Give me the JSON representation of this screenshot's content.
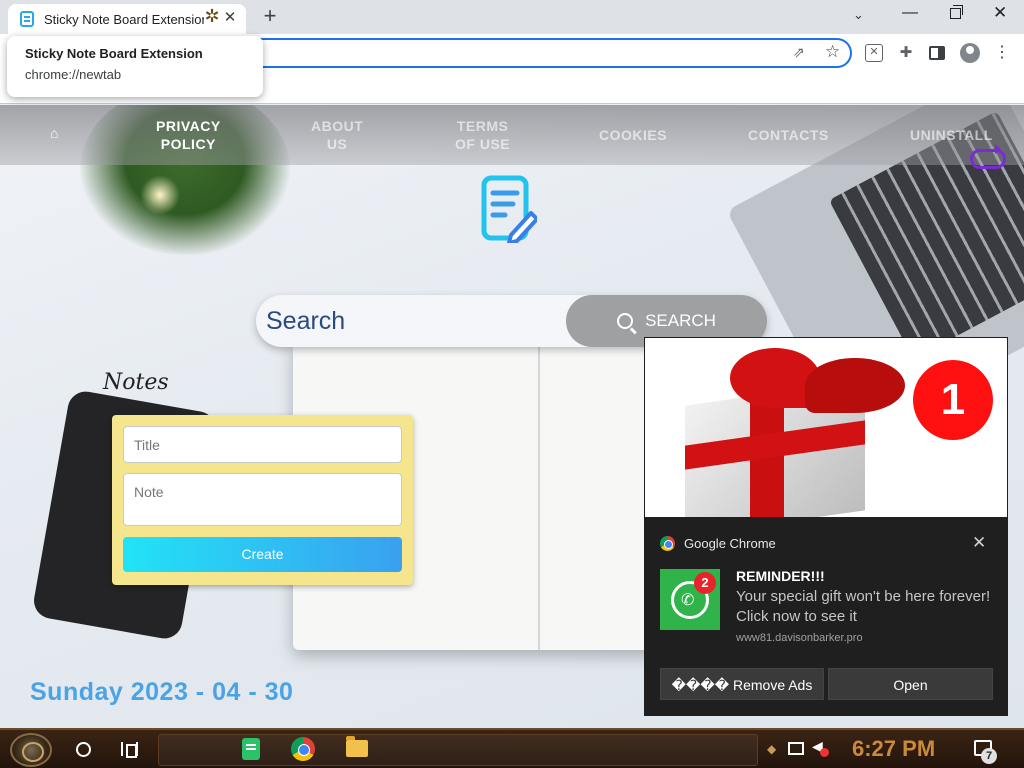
{
  "browser": {
    "tab_title": "Sticky Note Board Extension",
    "hover_card": {
      "title": "Sticky Note Board Extension",
      "url": "chrome://newtab"
    }
  },
  "nav": {
    "privacy": "PRIVACY\nPOLICY",
    "about": "ABOUT\nUS",
    "terms": "TERMS\nOF USE",
    "cookies": "COOKIES",
    "contacts": "CONTACTS",
    "uninstall": "UNINSTALL"
  },
  "search": {
    "placeholder": "Search",
    "button_label": "SEARCH"
  },
  "notes": {
    "heading": "Notes",
    "title_placeholder": "Title",
    "note_placeholder": "Note",
    "create_label": "Create"
  },
  "date": "Sunday 2023 - 04 - 30",
  "notification": {
    "badge_image": "1",
    "app_name": "Google Chrome",
    "icon_badge": "2",
    "title": "REMINDER!!!",
    "body": "Your special gift won't be here forever! Click now to see it",
    "source": "www81.davisonbarker.pro",
    "btn_remove": "���� Remove Ads",
    "btn_open": "Open"
  },
  "taskbar": {
    "clock": "6:27 PM",
    "notification_count": "7"
  },
  "colors": {
    "accent": "#1a73e8",
    "date": "#4aa3e6",
    "note_card": "#f5e68e",
    "create_gradient_start": "#22e3f6"
  }
}
